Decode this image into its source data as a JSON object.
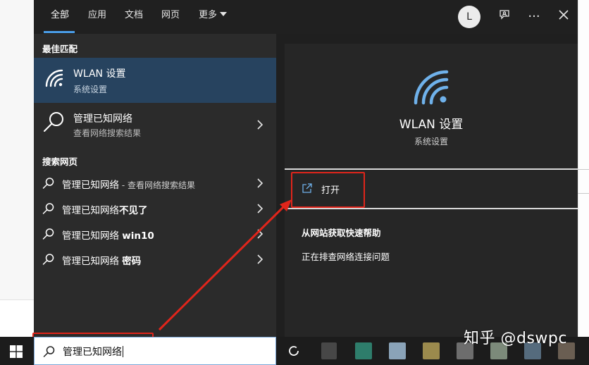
{
  "tabs": [
    {
      "label": "全部"
    },
    {
      "label": "应用"
    },
    {
      "label": "文档"
    },
    {
      "label": "网页"
    },
    {
      "label": "更多"
    }
  ],
  "header": {
    "avatar_initial": "L",
    "feedback_icon": "feedback-icon",
    "more_icon": "ellipsis-icon",
    "close_icon": "close-icon"
  },
  "best_match": {
    "section_label": "最佳匹配",
    "title": "WLAN 设置",
    "subtitle": "系统设置",
    "icon": "wifi-icon"
  },
  "web_result": {
    "title": "管理已知网络",
    "subtitle": "查看网络搜索结果",
    "icon": "search-icon"
  },
  "search_web": {
    "section_label": "搜索网页",
    "items": [
      {
        "main": "管理已知网络",
        "extra": " - 查看网络搜索结果",
        "bold": ""
      },
      {
        "main": "管理已知网络",
        "extra": "",
        "bold": "不见了"
      },
      {
        "main": "管理已知网络 ",
        "extra": "",
        "bold": "win10"
      },
      {
        "main": "管理已知网络 ",
        "extra": "",
        "bold": "密码"
      }
    ]
  },
  "preview": {
    "title": "WLAN 设置",
    "subtitle": "系统设置",
    "open_label": "打开",
    "help_title": "从网站获取快速帮助",
    "help_item": "正在排查网络连接问题"
  },
  "search_box": {
    "value": "管理已知网络"
  },
  "watermark": "知乎 @dswpc",
  "colors": {
    "accent": "#4a9de8",
    "selected_row": "#27435f",
    "annotation_red": "#e0251b"
  }
}
